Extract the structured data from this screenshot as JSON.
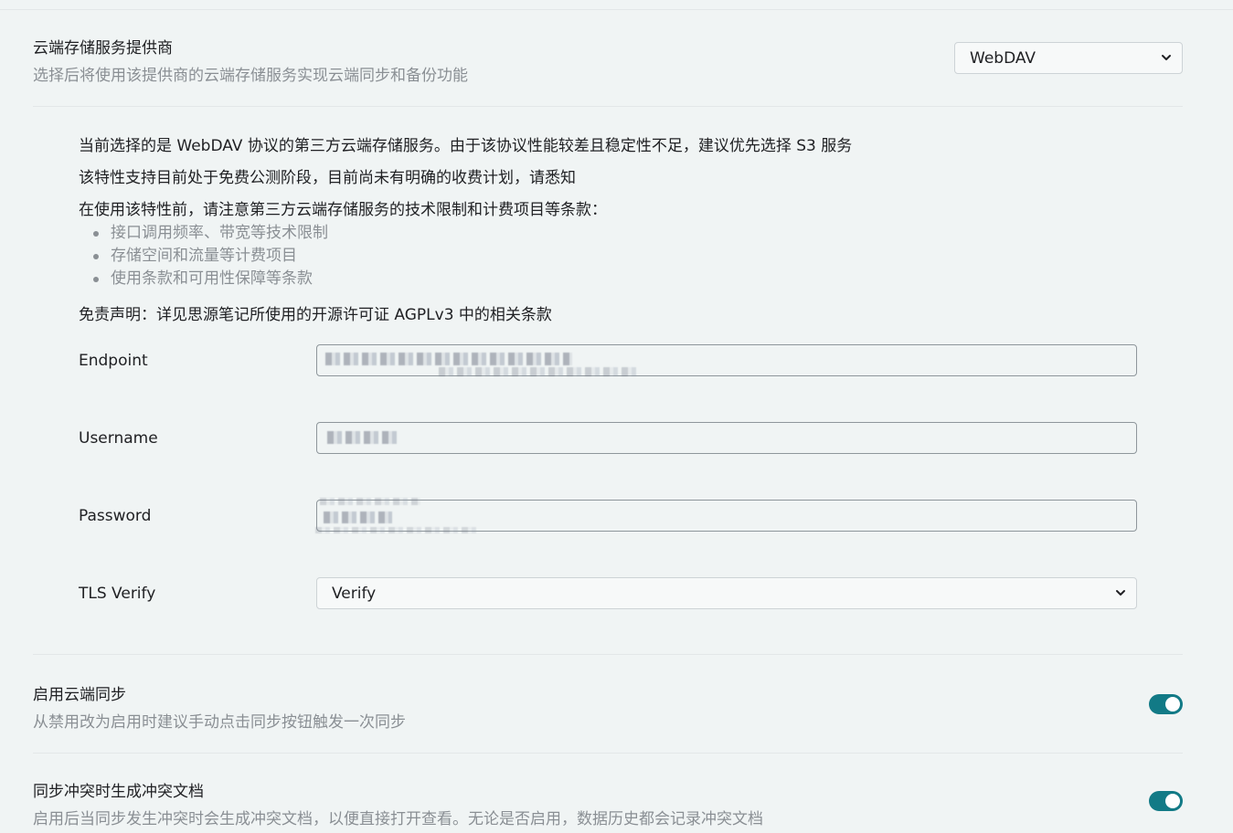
{
  "provider": {
    "title": "云端存储服务提供商",
    "description": "选择后将使用该提供商的云端存储服务实现云端同步和备份功能",
    "selected": "WebDAV",
    "chevron_icon": "chevron-down-icon"
  },
  "notice": {
    "line1": "当前选择的是 WebDAV 协议的第三方云端存储服务。由于该协议性能较差且稳定性不足，建议优先选择 S3 服务",
    "line2": "该特性支持目前处于免费公测阶段，目前尚未有明确的收费计划，请悉知",
    "line3": "在使用该特性前，请注意第三方云端存储服务的技术限制和计费项目等条款：",
    "bullets": [
      "接口调用频率、带宽等技术限制",
      "存储空间和流量等计费项目",
      "使用条款和可用性保障等条款"
    ],
    "disclaimer": "免责声明：详见思源笔记所使用的开源许可证 AGPLv3 中的相关条款"
  },
  "fields": {
    "endpoint_label": "Endpoint",
    "username_label": "Username",
    "password_label": "Password",
    "tls_label": "TLS Verify",
    "tls_selected": "Verify"
  },
  "sync": {
    "title": "启用云端同步",
    "description": "从禁用改为启用时建议手动点击同步按钮触发一次同步",
    "enabled": true
  },
  "conflict": {
    "title": "同步冲突时生成冲突文档",
    "description": "启用后当同步发生冲突时会生成冲突文档，以便直接打开查看。无论是否启用，数据历史都会记录冲突文档",
    "enabled": true
  },
  "colors": {
    "accent": "#127a86",
    "background": "#f0f4f4",
    "muted_text": "#8a8f94"
  }
}
